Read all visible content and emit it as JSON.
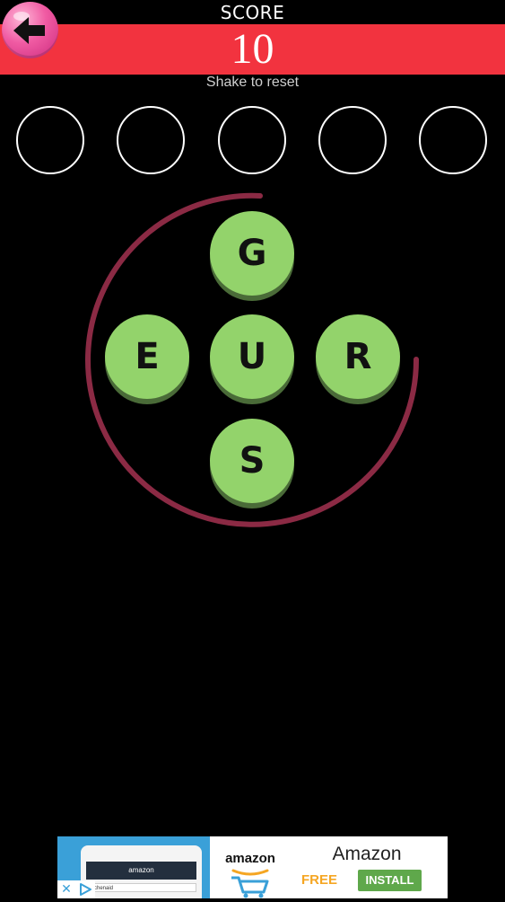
{
  "header": {
    "score_label": "SCORE",
    "score_value": "10",
    "reset_hint": "Shake to reset",
    "bar_color": "#f2333f"
  },
  "back_button": {
    "icon": "arrow-left-icon",
    "color": "#f05ba3"
  },
  "answer_slots": [
    "",
    "",
    "",
    "",
    ""
  ],
  "letter_wheel": {
    "ring_color": "#8b2a44",
    "tile_color": "#93d36b",
    "tiles": [
      {
        "letter": "G",
        "slot": "top"
      },
      {
        "letter": "E",
        "slot": "left"
      },
      {
        "letter": "U",
        "slot": "center"
      },
      {
        "letter": "R",
        "slot": "right"
      },
      {
        "letter": "S",
        "slot": "bottom"
      }
    ]
  },
  "ad": {
    "brand": "amazon",
    "phone_brand": "amazon",
    "search_text": "kitchenaid",
    "title": "Amazon",
    "price": "FREE",
    "install_label": "INSTALL",
    "close_icon": "close-icon",
    "adchoices_icon": "adchoices-icon"
  }
}
